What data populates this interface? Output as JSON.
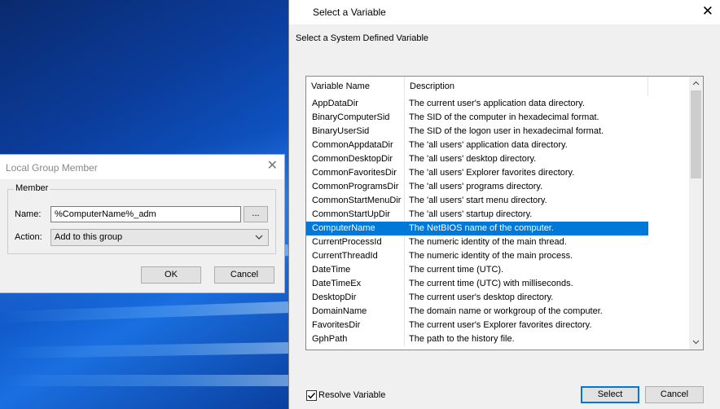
{
  "local_group_member": {
    "title": "Local Group Member",
    "group_label": "Member",
    "name_label": "Name:",
    "name_value": "%ComputerName%_adm",
    "browse_label": "...",
    "action_label": "Action:",
    "action_value": "Add to this group",
    "ok_label": "OK",
    "cancel_label": "Cancel"
  },
  "select_variable": {
    "title": "Select a Variable",
    "subtitle": "Select a System Defined Variable",
    "columns": [
      "Variable Name",
      "Description"
    ],
    "rows": [
      {
        "name": "AppDataDir",
        "desc": "The current user's application data directory."
      },
      {
        "name": "BinaryComputerSid",
        "desc": "The SID of the computer in hexadecimal format."
      },
      {
        "name": "BinaryUserSid",
        "desc": "The SID of the logon user in hexadecimal format."
      },
      {
        "name": "CommonAppdataDir",
        "desc": "The 'all users' application data directory."
      },
      {
        "name": "CommonDesktopDir",
        "desc": "The 'all users' desktop directory."
      },
      {
        "name": "CommonFavoritesDir",
        "desc": "The 'all users' Explorer favorites directory."
      },
      {
        "name": "CommonProgramsDir",
        "desc": "The 'all users' programs directory."
      },
      {
        "name": "CommonStartMenuDir",
        "desc": "The 'all users' start menu directory."
      },
      {
        "name": "CommonStartUpDir",
        "desc": "The 'all users' startup directory."
      },
      {
        "name": "ComputerName",
        "desc": "The NetBIOS name of the computer."
      },
      {
        "name": "CurrentProcessId",
        "desc": "The numeric identity of the main thread."
      },
      {
        "name": "CurrentThreadId",
        "desc": "The numeric identity of the main process."
      },
      {
        "name": "DateTime",
        "desc": "The current time (UTC)."
      },
      {
        "name": "DateTimeEx",
        "desc": "The current time (UTC) with milliseconds."
      },
      {
        "name": "DesktopDir",
        "desc": "The current user's desktop directory."
      },
      {
        "name": "DomainName",
        "desc": "The domain name or workgroup of the computer."
      },
      {
        "name": "FavoritesDir",
        "desc": "The current user's Explorer favorites directory."
      },
      {
        "name": "GphPath",
        "desc": "The path to the history file."
      }
    ],
    "selected_index": 9,
    "resolve_label": "Resolve Variable",
    "resolve_checked": true,
    "select_label": "Select",
    "cancel_label": "Cancel"
  },
  "colors": {
    "selection": "#0078d7",
    "dialog_bg": "#f0f0f0"
  }
}
